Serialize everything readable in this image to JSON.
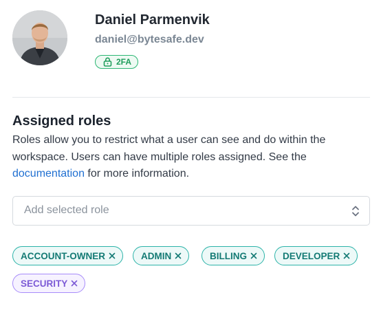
{
  "user": {
    "name": "Daniel Parmenvik",
    "email": "daniel@bytesafe.dev",
    "badge_2fa": "2FA"
  },
  "roles": {
    "title": "Assigned roles",
    "description_before": "Roles allow you to restrict what a user can see and do within the workspace. Users can have multiple roles assigned. See the",
    "documentation_link": "documentation",
    "description_after": "for more information.",
    "select_placeholder": "Add selected role",
    "assigned": [
      {
        "label": "ACCOUNT-OWNER",
        "color": "teal"
      },
      {
        "label": "ADMIN",
        "color": "teal"
      },
      {
        "label": "BILLING",
        "color": "teal"
      },
      {
        "label": "DEVELOPER",
        "color": "teal"
      },
      {
        "label": "SECURITY",
        "color": "purple"
      }
    ]
  },
  "icons": {
    "lock": "lock-icon",
    "remove": "close-icon",
    "select_toggle": "chevron-up-down-icon"
  },
  "colors": {
    "badge_green": "#2bb673",
    "chip_teal": "#2bb3a8",
    "chip_purple": "#a78bfa",
    "link_blue": "#1f6fd1"
  }
}
